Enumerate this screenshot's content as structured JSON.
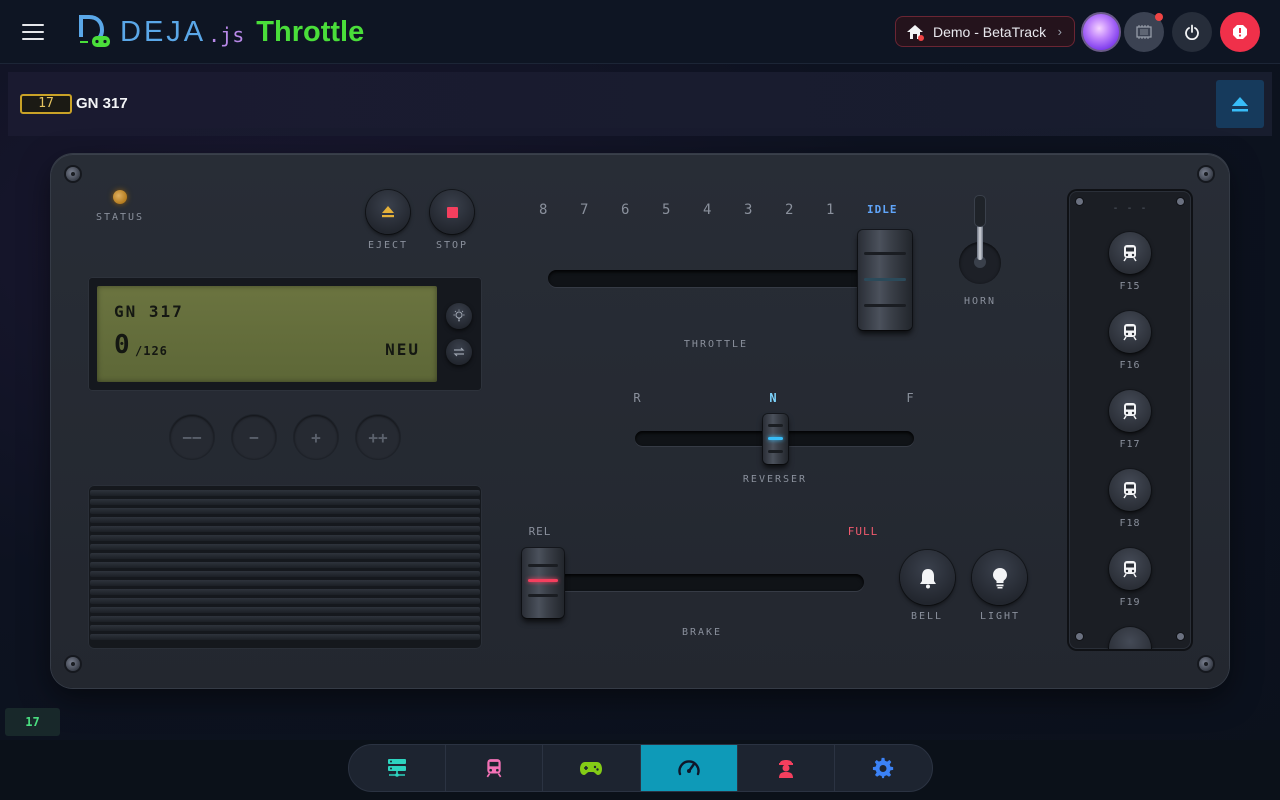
{
  "header": {
    "menu_icon": "hamburger-menu-icon",
    "logo_name": "DEJA",
    "logo_suffix": ".js",
    "app_name": "Throttle",
    "layout_selector": "Demo - BetaTrack",
    "layout_chevron": "›",
    "colors": {
      "brand_blue": "#5aa7e8",
      "brand_green": "#4ade3a",
      "estop_red": "#f0304a"
    }
  },
  "loco_bar": {
    "address": "17",
    "name": "GN 317"
  },
  "throttle_panel": {
    "status_label": "STATUS",
    "eject_label": "EJECT",
    "stop_label": "STOP",
    "display": {
      "name": "GN 317",
      "speed": "0",
      "max": "/126",
      "direction": "NEU"
    },
    "step_buttons": [
      "−−",
      "−",
      "+",
      "++"
    ],
    "throttle": {
      "notches": [
        "8",
        "7",
        "6",
        "5",
        "4",
        "3",
        "2",
        "1"
      ],
      "idle_label": "IDLE",
      "label": "THROTTLE",
      "position": 0
    },
    "horn_label": "HORN",
    "reverser": {
      "r_label": "R",
      "n_label": "N",
      "f_label": "F",
      "label": "REVERSER",
      "value": "N"
    },
    "brake": {
      "rel_label": "REL",
      "full_label": "FULL",
      "label": "BRAKE",
      "position": 0
    },
    "bell_label": "BELL",
    "light_label": "LIGHT",
    "functions": {
      "header": "- - -",
      "items": [
        "F15",
        "F16",
        "F17",
        "F18",
        "F19"
      ]
    }
  },
  "footer": {
    "address_tag": "17",
    "nav": [
      {
        "name": "nav-layout",
        "icon": "server-icon",
        "color": "#2dd4bf"
      },
      {
        "name": "nav-roster",
        "icon": "train-icon",
        "color": "#f472b6"
      },
      {
        "name": "nav-conductor",
        "icon": "gamepad-icon",
        "color": "#84cc16"
      },
      {
        "name": "nav-throttle",
        "icon": "speedometer-icon",
        "color": "#0f172a",
        "active": true
      },
      {
        "name": "nav-engineer",
        "icon": "engineer-icon",
        "color": "#f43f5e"
      },
      {
        "name": "nav-settings",
        "icon": "gear-icon",
        "color": "#3b82f6"
      }
    ]
  }
}
